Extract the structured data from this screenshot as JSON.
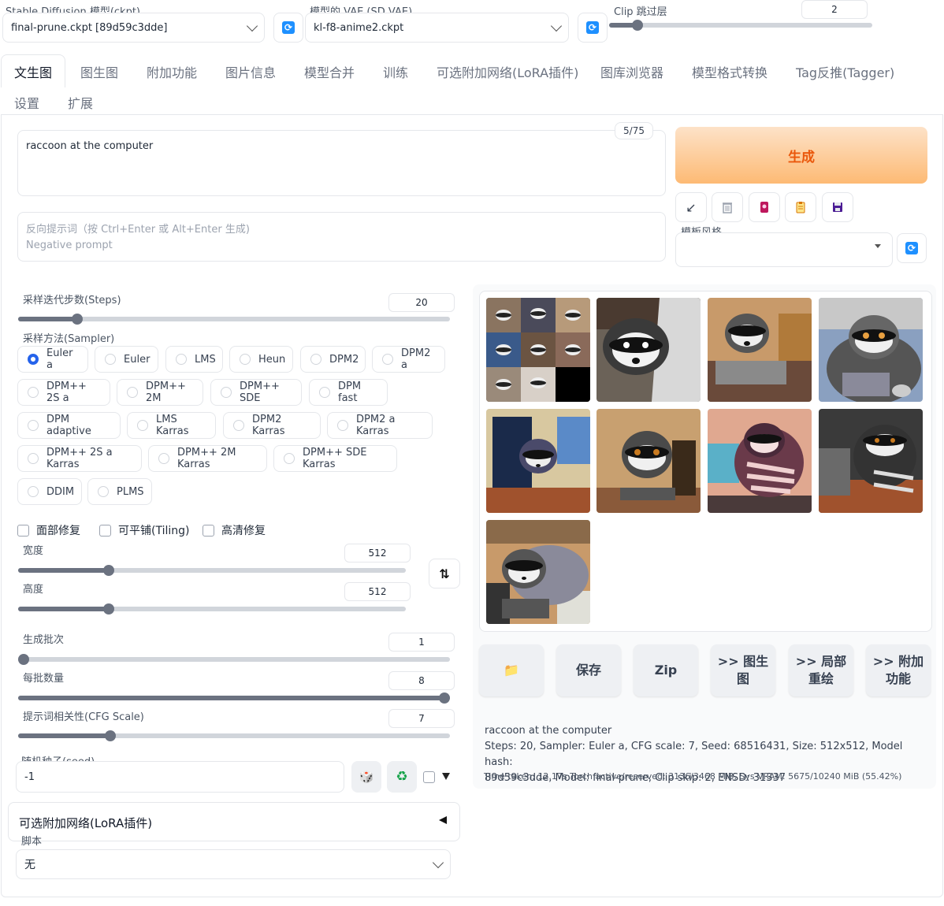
{
  "top": {
    "ckpt_label": "Stable Diffusion 模型(ckpt)",
    "ckpt_value": "final-prune.ckpt [89d59c3dde]",
    "vae_label": "模型的 VAE (SD VAE)",
    "vae_value": "kl-f8-anime2.ckpt",
    "clip_label": "Clip 跳过层",
    "clip_value": "2"
  },
  "tabs": [
    "文生图",
    "图生图",
    "附加功能",
    "图片信息",
    "模型合并",
    "训练",
    "可选附加网络(LoRA插件)",
    "图库浏览器",
    "模型格式转换",
    "Tag反推(Tagger)",
    "设置",
    "扩展"
  ],
  "prompt": {
    "value": "raccoon at the computer",
    "token_count": "5/75",
    "negative_placeholder_line1": "反向提示词（按 Ctrl+Enter 或 Alt+Enter 生成)",
    "negative_placeholder_line2": "Negative prompt"
  },
  "generate": {
    "label": "生成"
  },
  "style": {
    "label": "模板风格"
  },
  "steps": {
    "label": "采样迭代步数(Steps)",
    "value": "20",
    "fraction": 0.13
  },
  "sampler": {
    "label": "采样方法(Sampler)",
    "options": [
      "Euler a",
      "Euler",
      "LMS",
      "Heun",
      "DPM2",
      "DPM2 a",
      "DPM++ 2S a",
      "DPM++ 2M",
      "DPM++ SDE",
      "DPM fast",
      "DPM adaptive",
      "LMS Karras",
      "DPM2 Karras",
      "DPM2 a Karras",
      "DPM++ 2S a Karras",
      "DPM++ 2M Karras",
      "DPM++ SDE Karras",
      "DDIM",
      "PLMS"
    ],
    "selected": "Euler a"
  },
  "checks": {
    "face": "面部修复",
    "tiling": "可平铺(Tiling)",
    "hires": "高清修复"
  },
  "width": {
    "label": "宽度",
    "value": "512",
    "fraction": 0.23
  },
  "height": {
    "label": "高度",
    "value": "512",
    "fraction": 0.23
  },
  "batch_count": {
    "label": "生成批次",
    "value": "1",
    "fraction": 0.0
  },
  "batch_size": {
    "label": "每批数量",
    "value": "8",
    "fraction": 1.0
  },
  "cfg": {
    "label": "提示词相关性(CFG Scale)",
    "value": "7",
    "fraction": 0.21
  },
  "seed": {
    "label": "随机种子(seed)",
    "value": "-1"
  },
  "lora": {
    "label": "可选附加网络(LoRA插件)"
  },
  "script": {
    "label": "脚本",
    "value": "无"
  },
  "actions": {
    "folder": "📁",
    "save": "保存",
    "zip": "Zip",
    "img2img": ">> 图生图",
    "inpaint": ">> 局部重绘",
    "extras": ">> 附加功能"
  },
  "info": {
    "prompt": "raccoon at the computer",
    "params_line1": "Steps: 20, Sampler: Euler a, CFG scale: 7, Seed: 68516431, Size: 512x512, Model hash:",
    "params_line2": "89d59c3dde, Model: final-prune, Clip skip: 2, ENSD: 31337",
    "time": "Time taken: 12.17s  Torch active/reserved: 3136/3468 MiB, Sys VRAM: 5675/10240 MiB (55.42%)"
  },
  "colors": {
    "accent": "#2563eb",
    "generate_from": "#fde2c8",
    "generate_to": "#fdba74",
    "generate_text": "#ea580c"
  }
}
